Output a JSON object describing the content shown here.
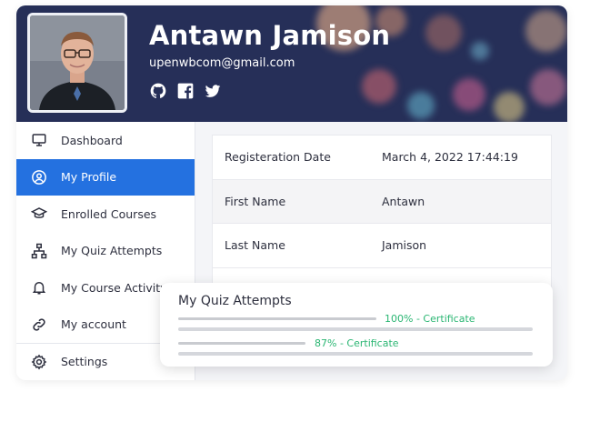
{
  "profile": {
    "name": "Antawn Jamison",
    "email": "upenwbcom@gmail.com",
    "socials": [
      "github-icon",
      "facebook-icon",
      "twitter-icon"
    ]
  },
  "sidebar": {
    "items": [
      {
        "label": "Dashboard",
        "icon": "monitor-icon"
      },
      {
        "label": "My Profile",
        "icon": "user-circle-icon",
        "active": true
      },
      {
        "label": "Enrolled Courses",
        "icon": "graduation-cap-icon"
      },
      {
        "label": "My Quiz Attempts",
        "icon": "sitemap-icon"
      },
      {
        "label": "My Course Activity",
        "icon": "bell-icon"
      },
      {
        "label": "My account",
        "icon": "link-icon"
      },
      {
        "label": "Settings",
        "icon": "gear-icon"
      }
    ]
  },
  "details": {
    "rows": [
      {
        "label": "Registeration Date",
        "value": "March 4, 2022 17:44:19"
      },
      {
        "label": "First Name",
        "value": "Antawn"
      },
      {
        "label": "Last Name",
        "value": "Jamison"
      }
    ]
  },
  "quiz": {
    "title": "My Quiz Attempts",
    "attempts": [
      {
        "label": "100% - Certificate",
        "percent": 100
      },
      {
        "label": "87% - Certificate",
        "percent": 87
      }
    ]
  },
  "colors": {
    "header_bg": "#262f58",
    "accent": "#2471e0",
    "success": "#2bb673"
  }
}
